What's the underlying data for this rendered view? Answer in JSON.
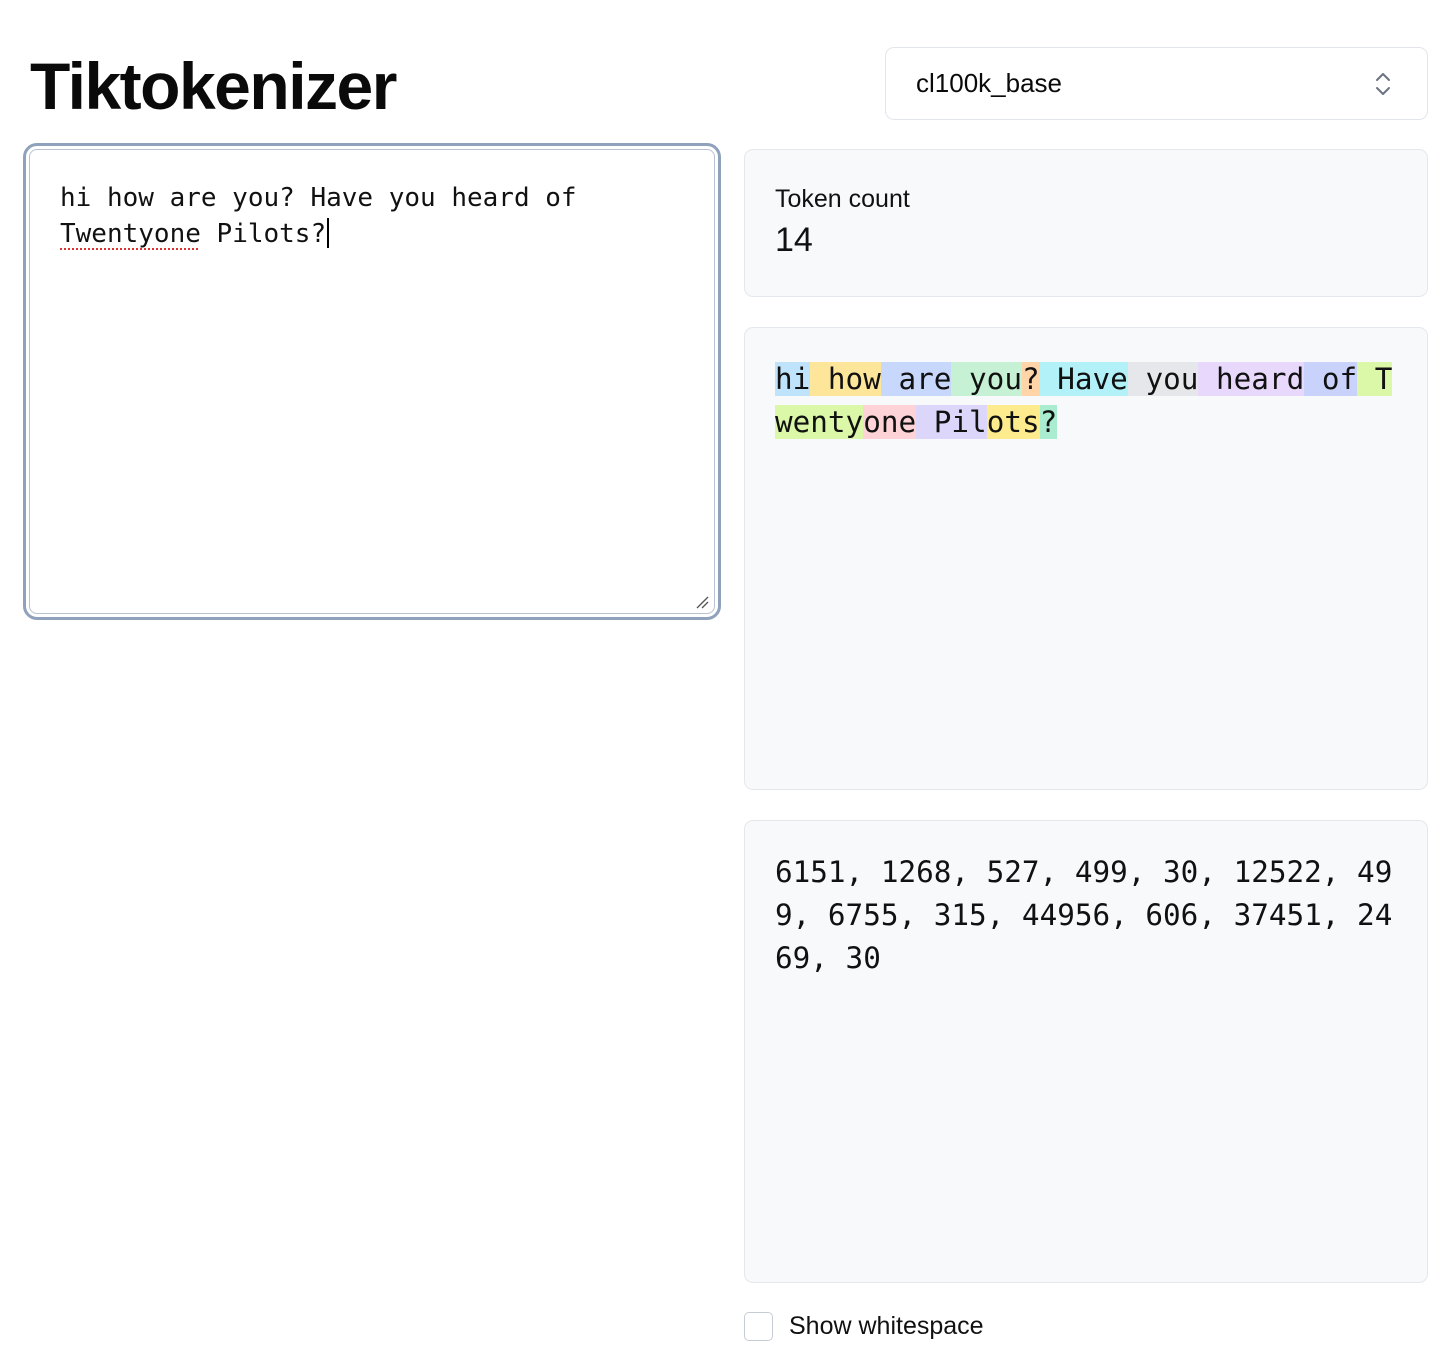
{
  "header": {
    "title": "Tiktokenizer"
  },
  "encoding_select": {
    "value": "cl100k_base",
    "icon": "chevron-up-down-icon"
  },
  "input": {
    "value_part1": "hi how are you? Have you heard of\n",
    "misspelled_word": "Twentyone",
    "value_part2": " Pilots?"
  },
  "stats": {
    "label": "Token count",
    "value": "14"
  },
  "tokens": [
    {
      "text": "hi",
      "color": "#bfe3fb"
    },
    {
      "text": " how",
      "color": "#fde69a"
    },
    {
      "text": " are",
      "color": "#c7d8fc"
    },
    {
      "text": " you",
      "color": "#c6f1d4"
    },
    {
      "text": "?",
      "color": "#fed4a8"
    },
    {
      "text": " Have",
      "color": "#b3f1f8"
    },
    {
      "text": " you",
      "color": "#e5e7eb"
    },
    {
      "text": " heard",
      "color": "#e8d9fc"
    },
    {
      "text": " of",
      "color": "#c9d2fb"
    },
    {
      "text": " Tw",
      "color": "#dbf7a8"
    },
    {
      "text": "enty",
      "color": "#dbf7a8"
    },
    {
      "text": "one",
      "color": "#fdd3d7"
    },
    {
      "text": " Pil",
      "color": "#ddd6fb"
    },
    {
      "text": "ots",
      "color": "#fdeb8d"
    },
    {
      "text": "?",
      "color": "#a9ecd0"
    }
  ],
  "token_ids": "6151, 1268, 527, 499, 30, 12522, 499, 6755, 315, 44956, 606, 37451, 2469, 30",
  "options": {
    "show_whitespace_label": "Show whitespace",
    "show_whitespace_checked": false
  }
}
